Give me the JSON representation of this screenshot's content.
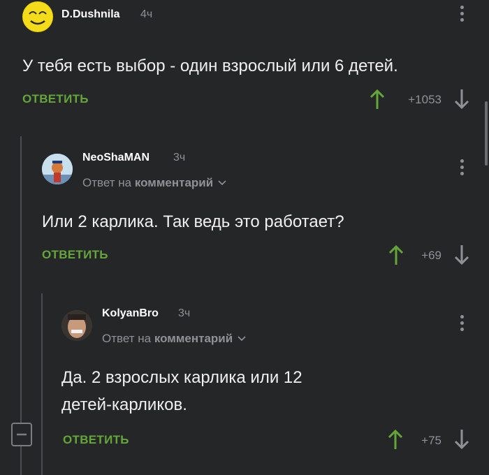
{
  "comments": [
    {
      "author": "D.Dushnila",
      "time": "4ч",
      "text": "У тебя есть выбор - один взрослый или 6 детей.",
      "reply_label": "ОТВЕТИТЬ",
      "score": "+1053"
    },
    {
      "author": "NeoShaMAN",
      "time": "3ч",
      "reply_prefix": "Ответ на",
      "reply_target": "комментарий",
      "text": "Или 2 карлика. Так ведь это работает?",
      "reply_label": "ОТВЕТИТЬ",
      "score": "+69"
    },
    {
      "author": "KolyanBro",
      "time": "3ч",
      "reply_prefix": "Ответ на",
      "reply_target": "комментарий",
      "text_line1": "Да. 2 взрослых карлика или 12",
      "text_line2": "детей-карликов.",
      "reply_label": "ОТВЕТИТЬ",
      "score": "+75"
    }
  ],
  "colors": {
    "accent": "#65a63a",
    "background": "#242628",
    "muted": "#8f9194"
  },
  "icons": [
    "upvote-icon",
    "downvote-icon",
    "more-icon",
    "collapse-icon",
    "chevron-down-icon"
  ]
}
